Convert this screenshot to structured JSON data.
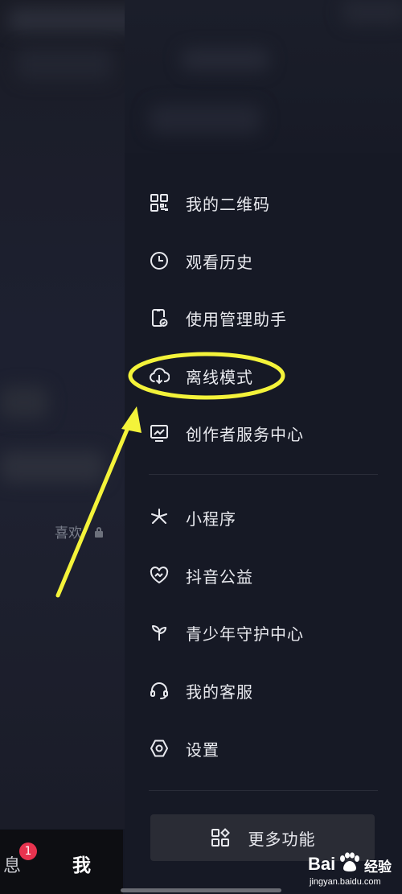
{
  "menu": {
    "items": [
      {
        "label": "我的二维码",
        "icon": "qr-code-icon"
      },
      {
        "label": "观看历史",
        "icon": "clock-icon"
      },
      {
        "label": "使用管理助手",
        "icon": "phone-check-icon"
      },
      {
        "label": "离线模式",
        "icon": "cloud-download-icon"
      },
      {
        "label": "创作者服务中心",
        "icon": "monitor-chart-icon"
      },
      {
        "label": "小程序",
        "icon": "mini-program-icon"
      },
      {
        "label": "抖音公益",
        "icon": "heart-hands-icon"
      },
      {
        "label": "青少年守护中心",
        "icon": "sprout-icon"
      },
      {
        "label": "我的客服",
        "icon": "headset-icon"
      },
      {
        "label": "设置",
        "icon": "hexagon-settings-icon"
      }
    ],
    "more_button": {
      "label": "更多功能",
      "icon": "grid-apps-icon"
    }
  },
  "background": {
    "likes_label": "喜欢"
  },
  "bottom_nav": {
    "message_label": "息",
    "message_badge": "1",
    "me_label": "我"
  },
  "watermark": {
    "brand": "Bai",
    "word": "经验",
    "url": "jingyan.baidu.com"
  },
  "colors": {
    "highlight": "#f4f33a",
    "badge": "#e8334f",
    "drawer_bg": "#161925"
  }
}
